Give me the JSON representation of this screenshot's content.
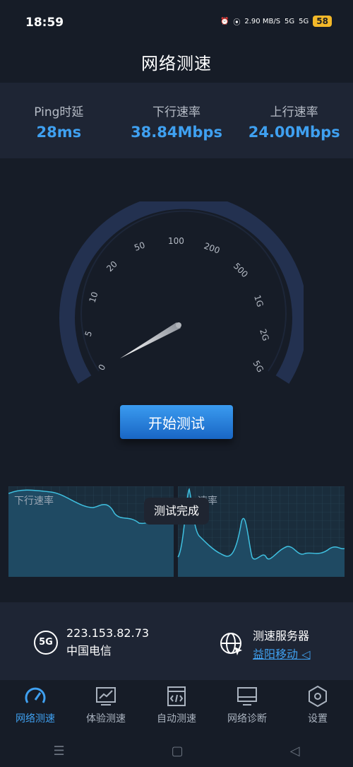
{
  "status": {
    "time": "18:59",
    "net_speed": "2.90 MB/S",
    "signal_a": "5G",
    "signal_b": "5G",
    "battery": "58"
  },
  "header": {
    "title": "网络测速"
  },
  "metrics": [
    {
      "label": "Ping时延",
      "value": "28ms"
    },
    {
      "label": "下行速率",
      "value": "38.84Mbps"
    },
    {
      "label": "上行速率",
      "value": "24.00Mbps"
    }
  ],
  "gauge": {
    "ticks": [
      "0",
      "5",
      "10",
      "20",
      "50",
      "100",
      "200",
      "500",
      "1G",
      "2G",
      "5G"
    ],
    "needle_value": "0"
  },
  "start_button": "开始测试",
  "graphs": {
    "download_label": "下行速率",
    "upload_label": "速率"
  },
  "toast": "测试完成",
  "connection": {
    "badge": "5G",
    "ip": "223.153.82.73",
    "carrier": "中国电信"
  },
  "server": {
    "title": "测速服务器",
    "name": "益阳移动"
  },
  "tabs": [
    {
      "label": "网络测速",
      "icon": "speedometer-icon"
    },
    {
      "label": "体验测速",
      "icon": "chart-icon"
    },
    {
      "label": "自动测速",
      "icon": "code-icon"
    },
    {
      "label": "网络诊断",
      "icon": "monitor-icon"
    },
    {
      "label": "设置",
      "icon": "hexagon-settings-icon"
    }
  ],
  "colors": {
    "accent": "#3fa0f0",
    "bg": "#161c27",
    "panel": "#1e2534"
  }
}
